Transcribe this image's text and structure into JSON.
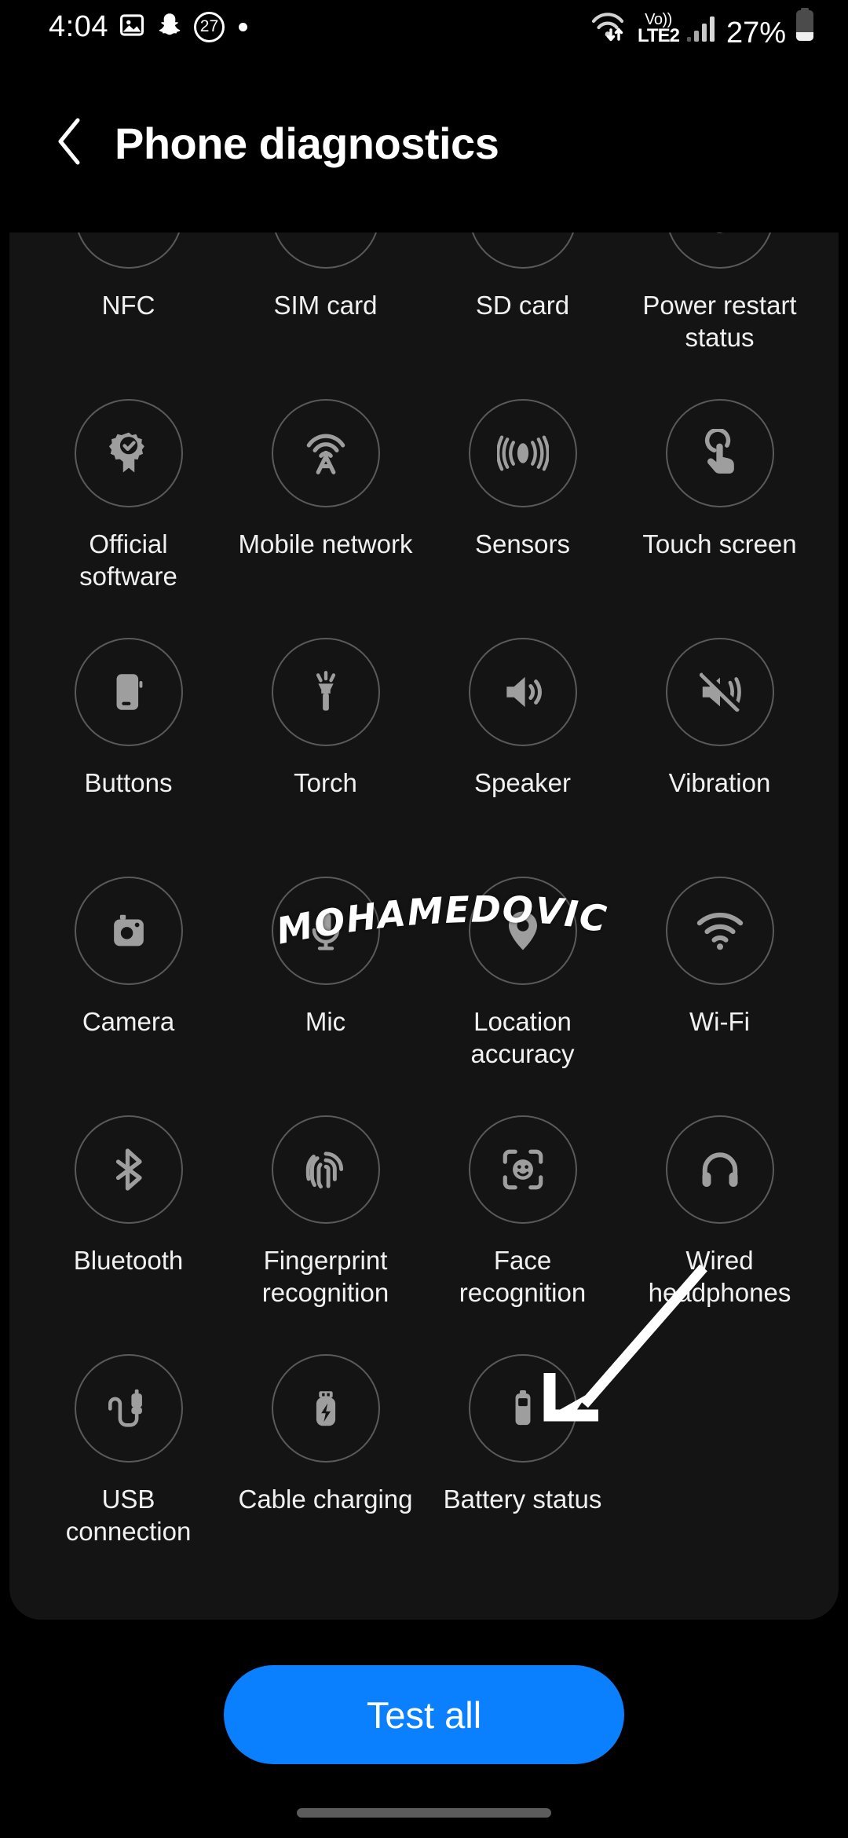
{
  "status_bar": {
    "time": "4:04",
    "icons": [
      "gallery-icon",
      "snapchat-icon"
    ],
    "notification_count": "27",
    "dot": "•",
    "wifi_icon": "wifi-data-icon",
    "volte_top": "Vo))",
    "volte_bottom": "LTE2",
    "signal_icon": "signal-bars-icon",
    "battery_percent": "27%",
    "battery_icon": "battery-icon"
  },
  "header": {
    "back_icon": "chevron-left-icon",
    "title": "Phone diagnostics"
  },
  "watermark": {
    "text": "MOHAMEDOVIC"
  },
  "grid": {
    "tiles": [
      {
        "label": "NFC",
        "icon": "nfc-icon"
      },
      {
        "label": "SIM card",
        "icon": "sim-card-icon"
      },
      {
        "label": "SD card",
        "icon": "sd-card-icon"
      },
      {
        "label": "Power restart status",
        "icon": "power-restart-icon"
      },
      {
        "label": "Official software",
        "icon": "badge-check-icon"
      },
      {
        "label": "Mobile network",
        "icon": "cell-tower-icon"
      },
      {
        "label": "Sensors",
        "icon": "sensors-icon"
      },
      {
        "label": "Touch screen",
        "icon": "touch-hand-icon"
      },
      {
        "label": "Buttons",
        "icon": "side-button-icon"
      },
      {
        "label": "Torch",
        "icon": "flashlight-icon"
      },
      {
        "label": "Speaker",
        "icon": "speaker-icon"
      },
      {
        "label": "Vibration",
        "icon": "vibration-mute-icon"
      },
      {
        "label": "Camera",
        "icon": "camera-icon"
      },
      {
        "label": "Mic",
        "icon": "microphone-icon"
      },
      {
        "label": "Location accuracy",
        "icon": "location-pin-icon"
      },
      {
        "label": "Wi-Fi",
        "icon": "wifi-icon"
      },
      {
        "label": "Bluetooth",
        "icon": "bluetooth-icon"
      },
      {
        "label": "Fingerprint recognition",
        "icon": "fingerprint-icon"
      },
      {
        "label": "Face recognition",
        "icon": "face-scan-icon"
      },
      {
        "label": "Wired headphones",
        "icon": "headphones-icon"
      },
      {
        "label": "USB connection",
        "icon": "usb-cable-icon"
      },
      {
        "label": "Cable charging",
        "icon": "usb-charging-icon"
      },
      {
        "label": "Battery status",
        "icon": "battery-status-icon"
      }
    ]
  },
  "footer": {
    "test_all_label": "Test all"
  },
  "colors": {
    "accent_blue": "#0a80ff",
    "card_background": "#141414",
    "page_background": "#000000",
    "icon_gray": "#9e9e9e",
    "circle_border": "#5a5a5a"
  }
}
